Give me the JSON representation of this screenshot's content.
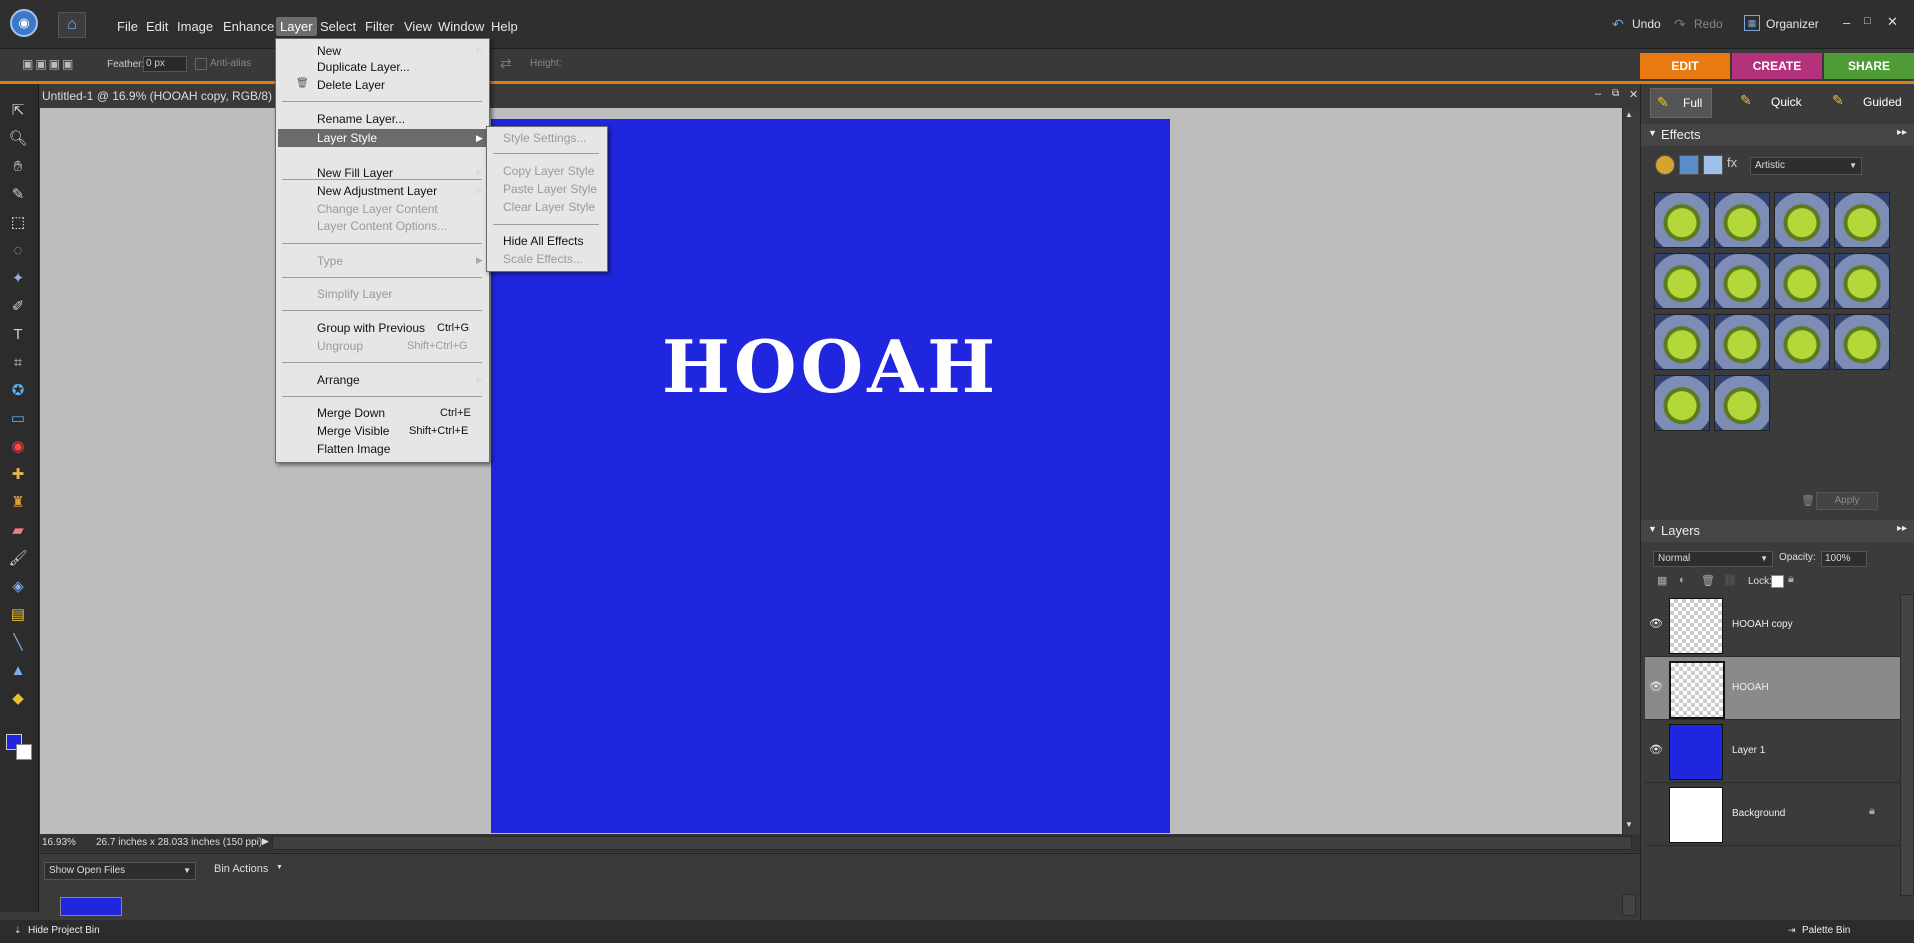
{
  "menubar": {
    "items": [
      "File",
      "Edit",
      "Image",
      "Enhance",
      "Layer",
      "Select",
      "Filter",
      "View",
      "Window",
      "Help"
    ],
    "undo": "Undo",
    "redo": "Redo",
    "organizer": "Organizer"
  },
  "options": {
    "feather_label": "Feather:",
    "feather_value": "0 px",
    "antialias": "Anti-alias",
    "height_label": "Height:"
  },
  "modes": {
    "edit": "EDIT",
    "create": "CREATE",
    "share": "SHARE",
    "full": "Full",
    "quick": "Quick",
    "guided": "Guided"
  },
  "document": {
    "title": "Untitled-1 @ 16.9% (HOOAH copy, RGB/8)",
    "canvas_text": "HOOAH",
    "canvas_color": "#1f26dd",
    "zoom": "16.93%",
    "doc_info": "26.7 inches x 28.033 inches (150 ppi)"
  },
  "layer_menu": {
    "items": [
      {
        "label": "New",
        "submenu": true
      },
      {
        "label": "Duplicate Layer..."
      },
      {
        "label": "Delete Layer"
      },
      {
        "label": "Rename Layer..."
      },
      {
        "label": "Layer Style",
        "submenu": true,
        "highlighted": true
      },
      {
        "label": "New Fill Layer",
        "submenu": true
      },
      {
        "label": "New Adjustment Layer",
        "submenu": true
      },
      {
        "label": "Change Layer Content",
        "disabled": true
      },
      {
        "label": "Layer Content Options...",
        "disabled": true
      },
      {
        "label": "Type",
        "disabled": true,
        "submenu": true
      },
      {
        "label": "Simplify Layer",
        "disabled": true
      },
      {
        "label": "Group with Previous",
        "shortcut": "Ctrl+G"
      },
      {
        "label": "Ungroup",
        "shortcut": "Shift+Ctrl+G",
        "disabled": true
      },
      {
        "label": "Arrange",
        "submenu": true
      },
      {
        "label": "Merge Down",
        "shortcut": "Ctrl+E"
      },
      {
        "label": "Merge Visible",
        "shortcut": "Shift+Ctrl+E"
      },
      {
        "label": "Flatten Image"
      }
    ]
  },
  "style_submenu": {
    "items": [
      {
        "label": "Style Settings...",
        "disabled": true
      },
      {
        "label": "Copy Layer Style",
        "disabled": true
      },
      {
        "label": "Paste Layer Style",
        "disabled": true
      },
      {
        "label": "Clear Layer Style",
        "disabled": true
      },
      {
        "label": "Hide All Effects"
      },
      {
        "label": "Scale Effects...",
        "disabled": true
      }
    ]
  },
  "effects": {
    "title": "Effects",
    "category": "Artistic",
    "apply": "Apply"
  },
  "layers": {
    "title": "Layers",
    "blend_mode": "Normal",
    "opacity_label": "Opacity:",
    "opacity_value": "100%",
    "lock_label": "Lock:",
    "rows": [
      {
        "name": "HOOAH copy",
        "visible": true
      },
      {
        "name": "HOOAH",
        "visible": true,
        "selected": true
      },
      {
        "name": "Layer 1",
        "visible": true
      },
      {
        "name": "Background",
        "visible": false,
        "locked": true
      }
    ]
  },
  "bin": {
    "show_open_files": "Show Open Files",
    "bin_actions": "Bin Actions",
    "hide_project_bin": "Hide Project Bin",
    "palette_bin": "Palette Bin"
  }
}
